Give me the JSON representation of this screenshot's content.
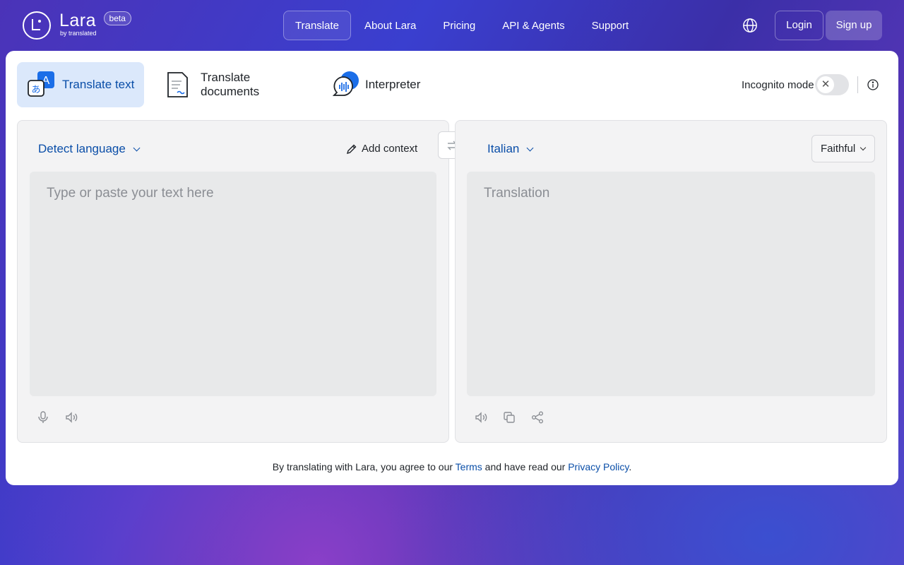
{
  "brand": {
    "name": "Lara",
    "sub": "by translated",
    "badge": "beta"
  },
  "nav": [
    {
      "label": "Translate",
      "active": true
    },
    {
      "label": "About Lara"
    },
    {
      "label": "Pricing"
    },
    {
      "label": "API & Agents"
    },
    {
      "label": "Support"
    }
  ],
  "header": {
    "language_icon": "globe-icon",
    "login": "Login",
    "signup": "Sign up"
  },
  "modes": [
    {
      "label": "Translate text",
      "icon": "translate-text-icon",
      "active": true
    },
    {
      "label": "Translate documents",
      "icon": "document-icon"
    },
    {
      "label": "Interpreter",
      "icon": "interpreter-icon"
    }
  ],
  "incognito": {
    "label": "Incognito mode",
    "enabled": false
  },
  "source": {
    "language": "Detect language",
    "add_context": "Add context",
    "placeholder": "Type or paste your text here"
  },
  "target": {
    "language": "Italian",
    "style": "Faithful",
    "placeholder": "Translation"
  },
  "footer": {
    "prefix": "By translating with Lara, you agree to our ",
    "terms": "Terms",
    "middle": " and have read our ",
    "privacy": "Privacy Policy",
    "suffix": "."
  },
  "colors": {
    "accent": "#0a4ea8",
    "active_tab_bg": "#dbe8fb",
    "card_bg": "#ffffff"
  }
}
